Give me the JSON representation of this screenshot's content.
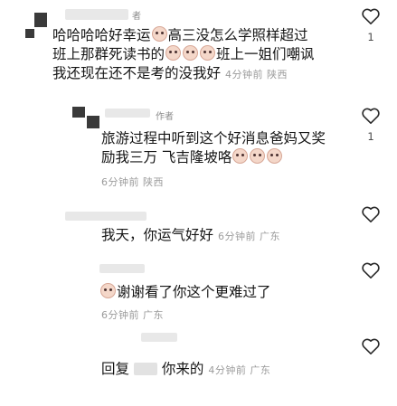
{
  "comments": [
    {
      "author_tag": "者",
      "text_lines": [
        "哈哈哈哈好幸运",
        "高三没怎么学照样超过",
        "班上那群死读书的",
        "班上一姐们嘲讽",
        "我还现在还不是考的没我好"
      ],
      "time": "4分钟前",
      "location": "陕西",
      "likes": "1"
    },
    {
      "author_tag": "作者",
      "text_lines": [
        "旅游过程中听到这个好消息爸妈又奖",
        "励我三万 飞吉隆坡咯"
      ],
      "time": "6分钟前",
      "location": "陕西",
      "likes": "1"
    },
    {
      "text": "我天，你运气好好",
      "time": "6分钟前",
      "location": "广东"
    },
    {
      "text": "谢谢看了你这个更难过了",
      "time": "6分钟前",
      "location": "广东"
    },
    {
      "prefix": "回复",
      "text": "你来的",
      "time": "4分钟前",
      "location": "广东"
    }
  ]
}
